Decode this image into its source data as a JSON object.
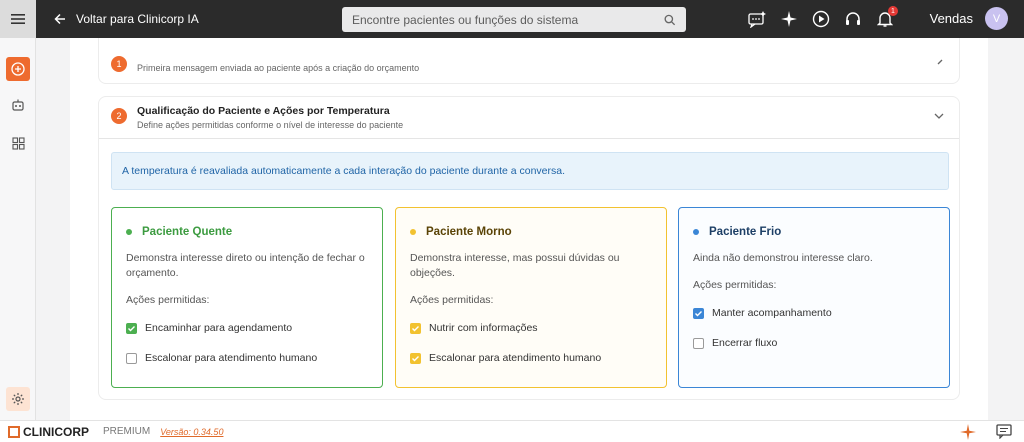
{
  "topbar": {
    "back_label": "Voltar para Clinicorp IA",
    "search_placeholder": "Encontre pacientes ou funções do sistema",
    "notification_count": "1",
    "user_name": "Vendas",
    "avatar_initial": "V"
  },
  "section1": {
    "number": "1",
    "subtitle": "Primeira mensagem enviada ao paciente após a criação do orçamento"
  },
  "section2": {
    "number": "2",
    "title": "Qualificação do Paciente e Ações por Temperatura",
    "subtitle": "Define ações permitidas conforme o nível de interesse do paciente",
    "info": "A temperatura é reavaliada automaticamente a cada interação do paciente durante a conversa."
  },
  "cards": [
    {
      "title": "Paciente Quente",
      "description": "Demonstra interesse direto ou intenção de fechar o orçamento.",
      "actions_label": "Ações permitidas:",
      "options": [
        {
          "label": "Encaminhar para agendamento",
          "checked": true
        },
        {
          "label": "Escalonar para atendimento humano",
          "checked": false
        }
      ]
    },
    {
      "title": "Paciente Morno",
      "description": "Demonstra interesse, mas possui dúvidas ou objeções.",
      "actions_label": "Ações permitidas:",
      "options": [
        {
          "label": "Nutrir com informações",
          "checked": true
        },
        {
          "label": "Escalonar para atendimento humano",
          "checked": true
        }
      ]
    },
    {
      "title": "Paciente Frio",
      "description": "Ainda não demonstrou interesse claro.",
      "actions_label": "Ações permitidas:",
      "options": [
        {
          "label": "Manter acompanhamento",
          "checked": true
        },
        {
          "label": "Encerrar fluxo",
          "checked": false
        }
      ]
    }
  ],
  "footer": {
    "logo_text": "CLINICORP",
    "plan": "PREMIUM",
    "version": "Versão: 0.34.50"
  },
  "colors": {
    "accent_orange": "#ee6b2f",
    "hot": "#4caf50",
    "warm": "#f2c230",
    "cold": "#3b86d6"
  }
}
